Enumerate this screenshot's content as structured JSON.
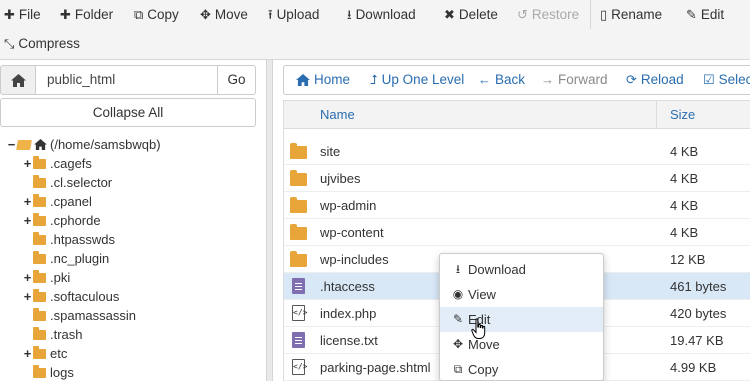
{
  "toolbar": {
    "row1": [
      {
        "label": "File",
        "icon": "plus-icon",
        "glyph": "✚"
      },
      {
        "label": "Folder",
        "icon": "plus-icon",
        "glyph": "✚"
      },
      {
        "label": "Copy",
        "icon": "copy-icon",
        "glyph": "⧉"
      },
      {
        "label": "Move",
        "icon": "move-icon",
        "glyph": "✥"
      },
      {
        "label": "Upload",
        "icon": "upload-icon",
        "glyph": "⭱"
      },
      {
        "label": "Download",
        "icon": "download-icon",
        "glyph": "⭳"
      },
      {
        "label": "Delete",
        "icon": "times-icon",
        "glyph": "✖"
      },
      {
        "label": "Restore",
        "icon": "undo-icon",
        "glyph": "↺"
      },
      {
        "label": "Rename",
        "icon": "file-icon",
        "glyph": "▯"
      },
      {
        "label": "Edit",
        "icon": "pencil-icon",
        "glyph": "✎"
      }
    ],
    "compress": {
      "label": "Compress",
      "icon": "compress-icon",
      "glyph": "⤡"
    }
  },
  "left": {
    "path_value": "public_html",
    "go_label": "Go",
    "collapse_label": "Collapse All",
    "tree": [
      {
        "label": "(/home/samsbwqb)",
        "toggle": "−",
        "level": 0,
        "root": true
      },
      {
        "label": ".cagefs",
        "toggle": "+",
        "level": 1
      },
      {
        "label": ".cl.selector",
        "toggle": "",
        "level": 1
      },
      {
        "label": ".cpanel",
        "toggle": "+",
        "level": 1
      },
      {
        "label": ".cphorde",
        "toggle": "+",
        "level": 1
      },
      {
        "label": ".htpasswds",
        "toggle": "",
        "level": 1
      },
      {
        "label": ".nc_plugin",
        "toggle": "",
        "level": 1
      },
      {
        "label": ".pki",
        "toggle": "+",
        "level": 1
      },
      {
        "label": ".softaculous",
        "toggle": "+",
        "level": 1
      },
      {
        "label": ".spamassassin",
        "toggle": "",
        "level": 1
      },
      {
        "label": ".trash",
        "toggle": "",
        "level": 1
      },
      {
        "label": "etc",
        "toggle": "+",
        "level": 1
      },
      {
        "label": "logs",
        "toggle": "",
        "level": 1
      }
    ]
  },
  "nav": [
    {
      "label": "Home",
      "icon": "home-icon",
      "glyph": "⌂",
      "disabled": false
    },
    {
      "label": "Up One Level",
      "icon": "level-up-icon",
      "glyph": "⮥",
      "disabled": false
    },
    {
      "label": "Back",
      "icon": "arrow-left-icon",
      "glyph": "←",
      "disabled": false
    },
    {
      "label": "Forward",
      "icon": "arrow-right-icon",
      "glyph": "→",
      "disabled": true
    },
    {
      "label": "Reload",
      "icon": "reload-icon",
      "glyph": "⟳",
      "disabled": false
    },
    {
      "label": "Select",
      "icon": "check-square-icon",
      "glyph": "☑",
      "disabled": false
    }
  ],
  "table": {
    "col_name": "Name",
    "col_size": "Size",
    "rows": [
      {
        "name": "site",
        "size": "4 KB",
        "type": "folder"
      },
      {
        "name": "ujvibes",
        "size": "4 KB",
        "type": "folder"
      },
      {
        "name": "wp-admin",
        "size": "4 KB",
        "type": "folder"
      },
      {
        "name": "wp-content",
        "size": "4 KB",
        "type": "folder"
      },
      {
        "name": "wp-includes",
        "size": "12 KB",
        "type": "folder"
      },
      {
        "name": ".htaccess",
        "size": "461 bytes",
        "type": "doc",
        "selected": true
      },
      {
        "name": "index.php",
        "size": "420 bytes",
        "type": "code"
      },
      {
        "name": "license.txt",
        "size": "19.47 KB",
        "type": "doc"
      },
      {
        "name": "parking-page.shtml",
        "size": "4.99 KB",
        "type": "code"
      }
    ]
  },
  "context_menu": [
    {
      "label": "Download",
      "icon": "download-icon",
      "glyph": "⭳"
    },
    {
      "label": "View",
      "icon": "eye-icon",
      "glyph": "◉"
    },
    {
      "label": "Edit",
      "icon": "pencil-icon",
      "glyph": "✎",
      "hover": true
    },
    {
      "label": "Move",
      "icon": "move-icon",
      "glyph": "✥"
    },
    {
      "label": "Copy",
      "icon": "copy-icon",
      "glyph": "⧉"
    }
  ]
}
